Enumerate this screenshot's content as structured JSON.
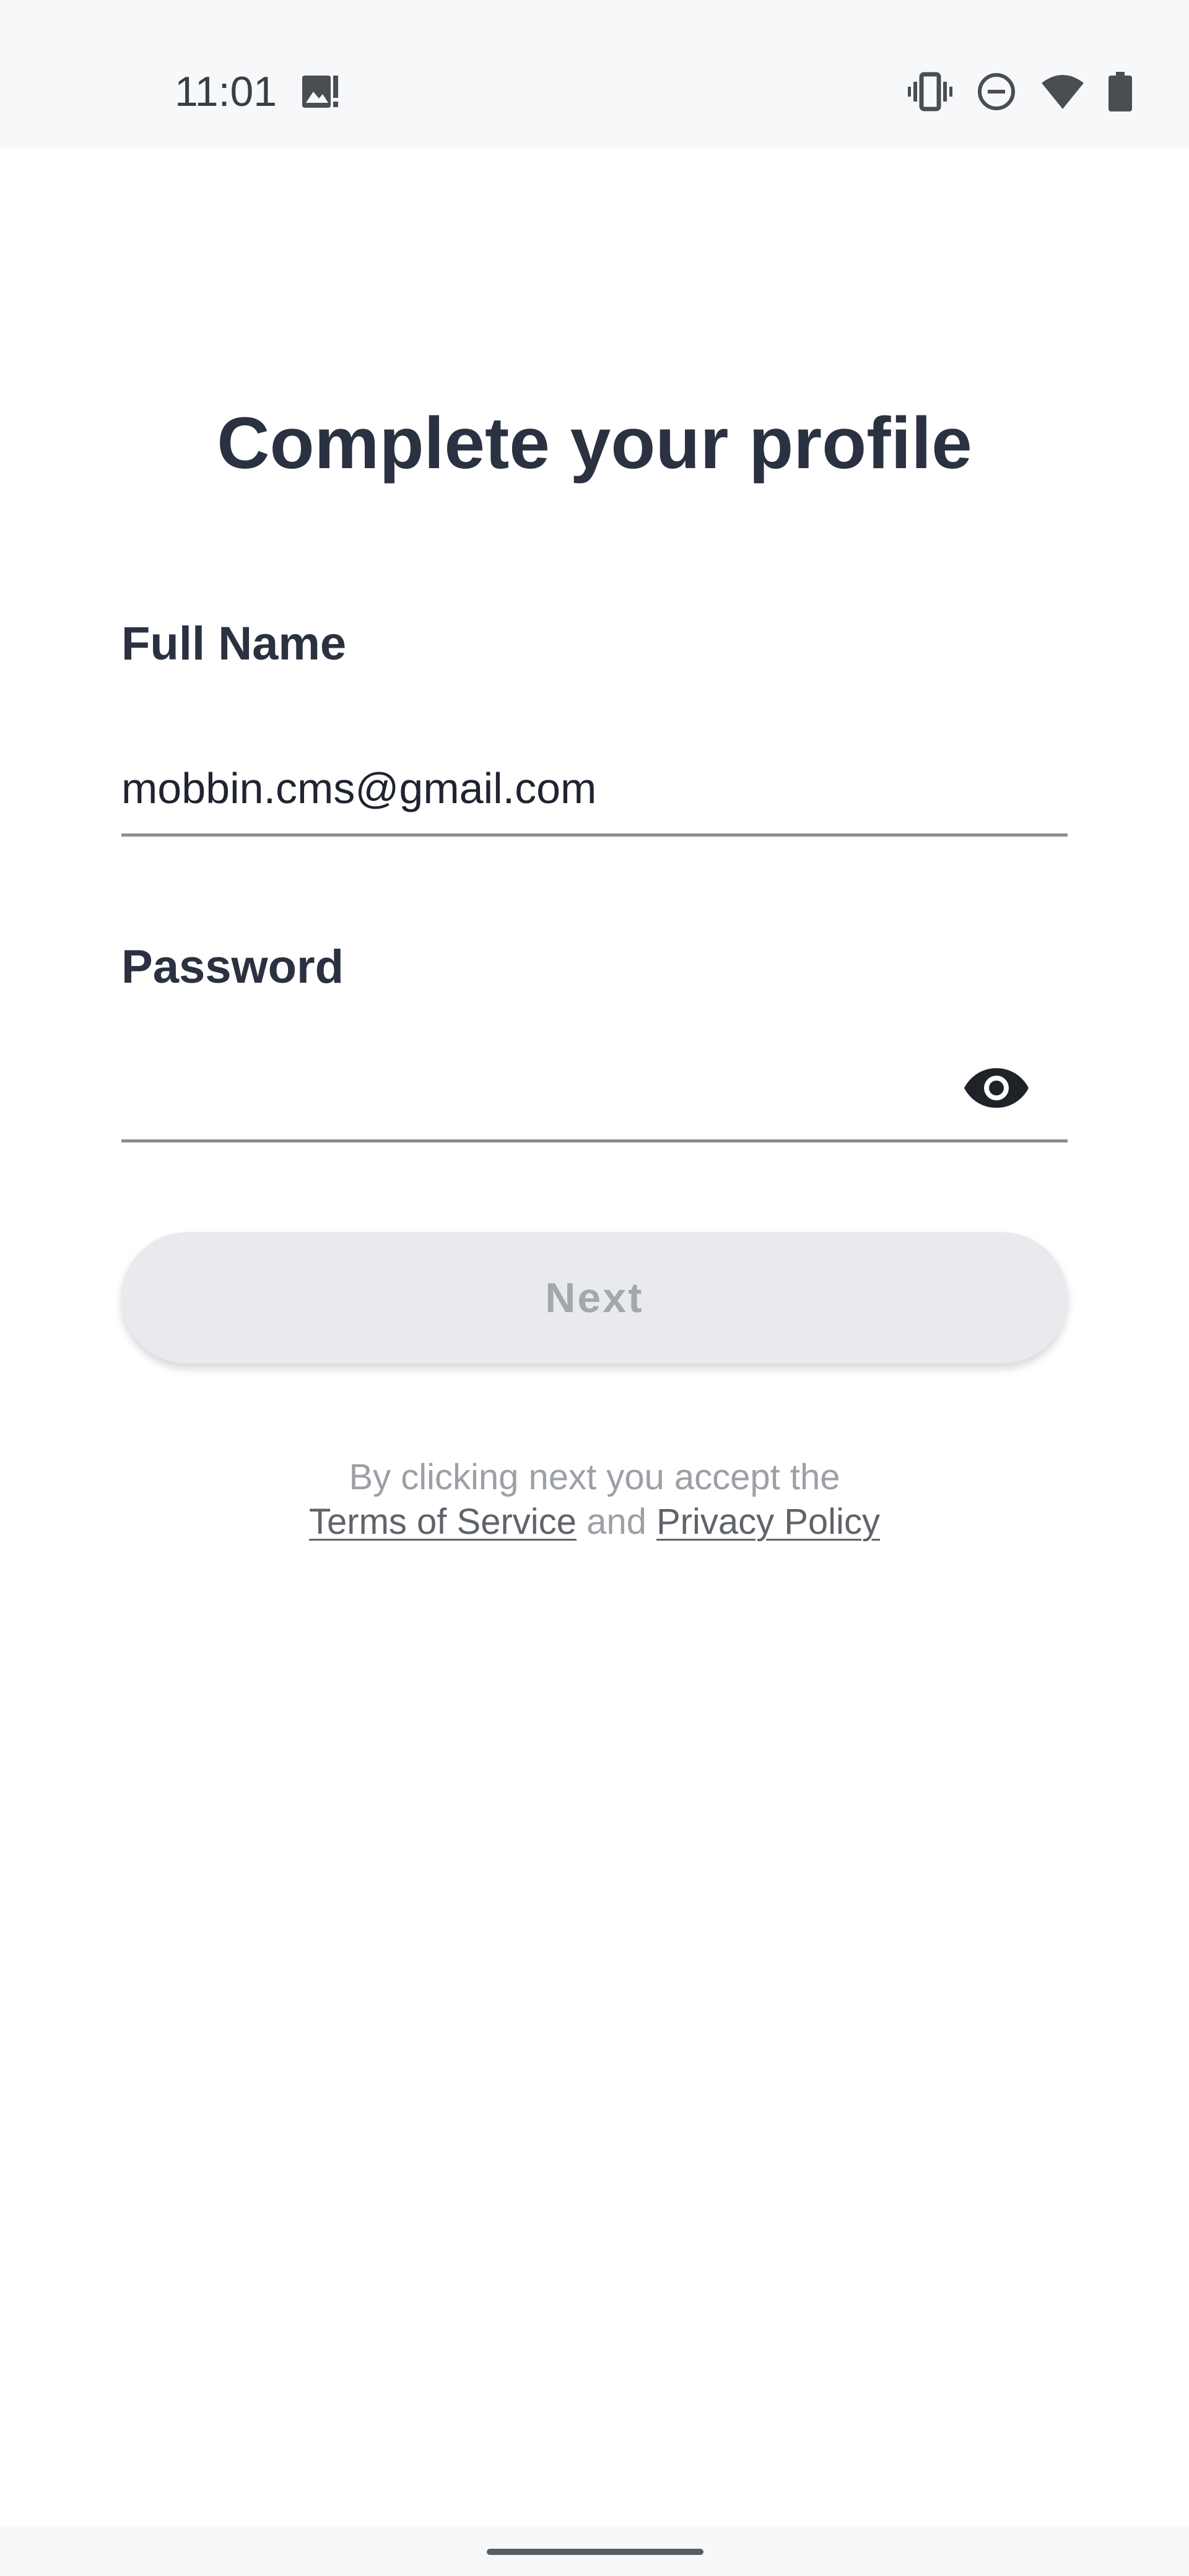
{
  "status_bar": {
    "time": "11:01",
    "icons": [
      "gallery-alert-icon",
      "vibrate-icon",
      "do-not-disturb-icon",
      "wifi-icon",
      "battery-icon"
    ]
  },
  "form": {
    "title": "Complete your profile",
    "full_name": {
      "label": "Full Name",
      "value": "mobbin.cms@gmail.com"
    },
    "password": {
      "label": "Password",
      "value": "",
      "toggle_icon": "eye-icon"
    },
    "next_label": "Next"
  },
  "legal": {
    "prefix": "By clicking next you accept the",
    "terms_link": "Terms of Service",
    "conjunction": "and",
    "privacy_link": "Privacy Policy"
  },
  "colors": {
    "heading": "#2a3140",
    "button_bg": "#e8eaed",
    "button_text": "#a4a8ae",
    "underline": "#8a8d91",
    "legal_text": "#9ca0a6",
    "link_text": "#5f636a",
    "status_bg": "#f7f8fa"
  }
}
